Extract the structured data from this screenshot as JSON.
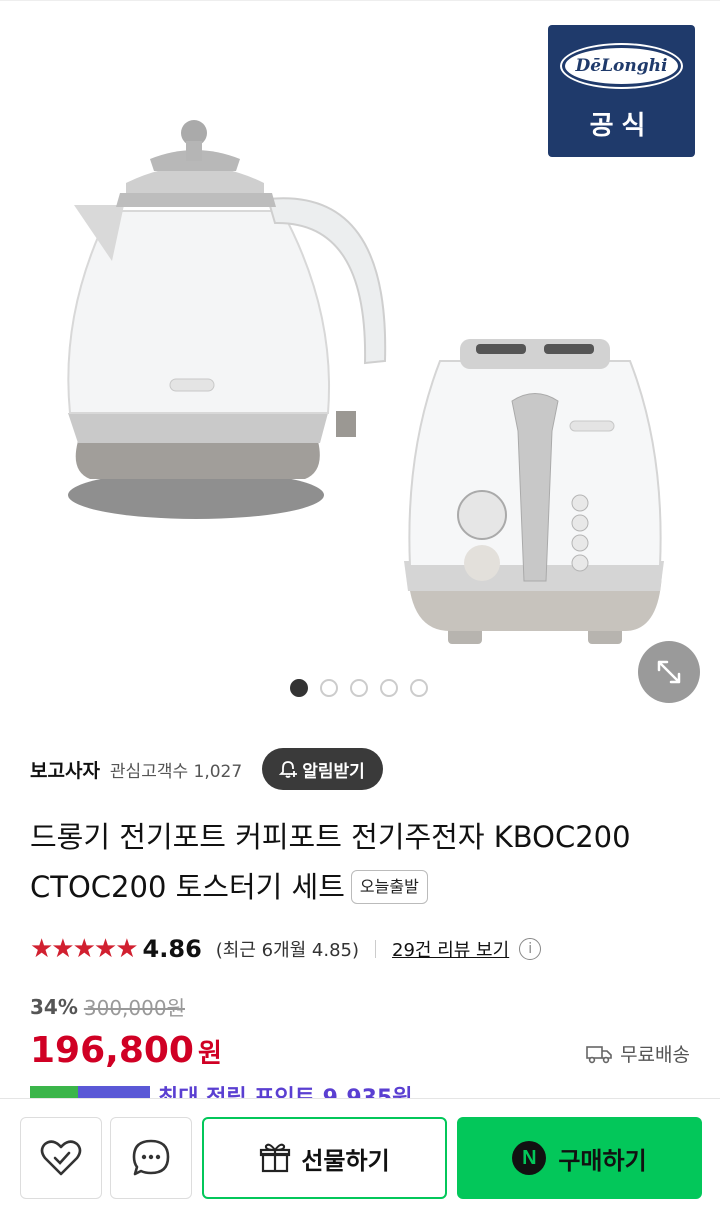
{
  "hero": {
    "brand": {
      "logo_text": "DēLonghi",
      "official_label": "공식"
    },
    "gallery": {
      "count": 5,
      "active_index": 0
    }
  },
  "store": {
    "name": "보고사자",
    "fans_label": "관심고객수 1,027",
    "alarm_label": "알림받기"
  },
  "product": {
    "title": "드롱기 전기포트 커피포트 전기주전자 KBOC200 CTOC200 토스터기 세트",
    "chip": "오늘출발"
  },
  "rating": {
    "stars": "★★★★★",
    "score": "4.86",
    "recent": "(최근 6개월 4.85)",
    "review_link": "29건 리뷰 보기"
  },
  "price": {
    "discount": "34%",
    "original": "300,000원",
    "sale": "196,800",
    "currency": "원",
    "shipping": "무료배송"
  },
  "points": {
    "text": "최대 적립 포인트 9,935원"
  },
  "bottom_bar": {
    "gift_label": "선물하기",
    "buy_label": "구매하기",
    "buy_logo": "N"
  },
  "colors": {
    "brand_navy": "#1f3a6b",
    "price_red": "#d00024",
    "naver_green": "#03c75a",
    "star_red": "#d12030"
  }
}
